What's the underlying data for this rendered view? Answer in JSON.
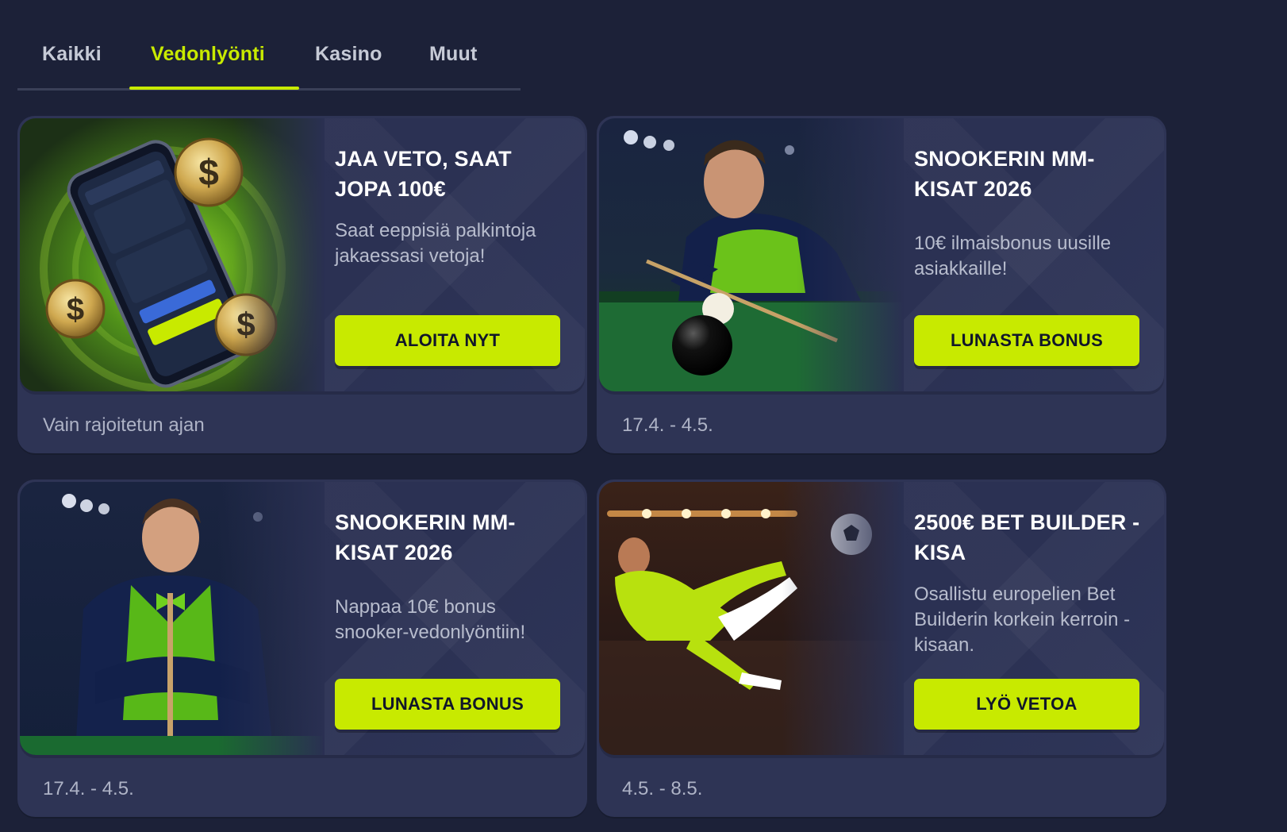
{
  "tabs": [
    {
      "label": "Kaikki",
      "active": false
    },
    {
      "label": "Vedonlyönti",
      "active": true
    },
    {
      "label": "Kasino",
      "active": false
    },
    {
      "label": "Muut",
      "active": false
    }
  ],
  "colors": {
    "accent": "#c8ea00",
    "background": "#1c2138",
    "card": "#2e3455",
    "text_muted": "#b7bccd"
  },
  "promos": [
    {
      "image": "phone-app-coins-illustration",
      "title": "JAA VETO, SAAT JOPA 100€",
      "description": "Saat eeppisiä palkintoja jakaessasi vetoja!",
      "button": "ALOITA NYT",
      "footer": "Vain rajoitetun ajan"
    },
    {
      "image": "snooker-player-cueing-photo",
      "title": "SNOOKERIN MM-KISAT 2026",
      "description": "10€ ilmaisbonus uusille asiakkaille!",
      "button": "LUNASTA BONUS",
      "footer": "17.4. - 4.5."
    },
    {
      "image": "snooker-player-arms-crossed-photo",
      "title": "SNOOKERIN MM-KISAT 2026",
      "description": "Nappaa 10€ bonus snooker-vedonlyöntiin!",
      "button": "LUNASTA BONUS",
      "footer": "17.4. - 4.5."
    },
    {
      "image": "football-player-volley-photo",
      "title": "2500€ BET BUILDER -KISA",
      "description": "Osallistu europelien Bet Builderin korkein kerroin -kisaan.",
      "button": "LYÖ VETOA",
      "footer": "4.5. - 8.5."
    }
  ]
}
